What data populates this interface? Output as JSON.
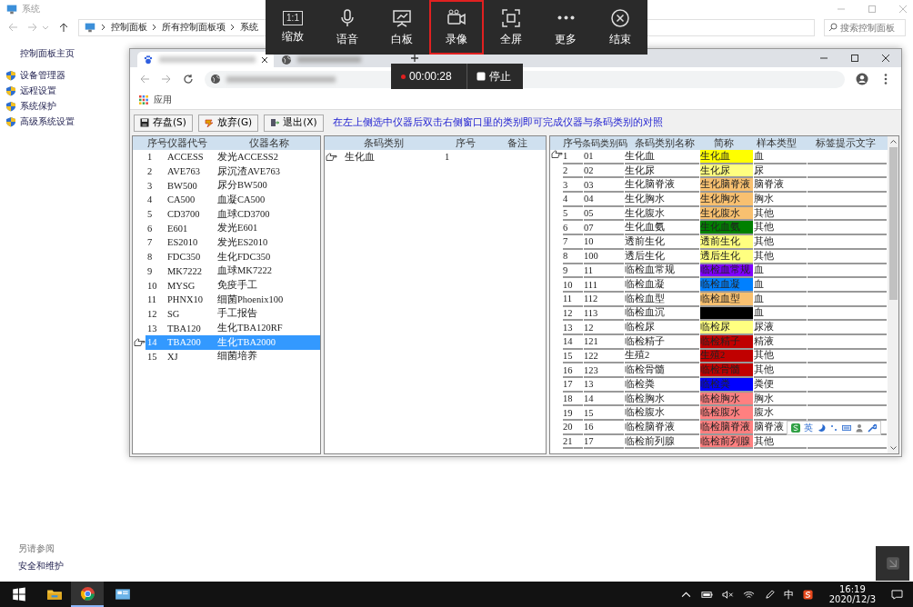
{
  "control_panel": {
    "title": "系统",
    "breadcrumb": [
      "控制面板",
      "所有控制面板项",
      "系统"
    ],
    "search": {
      "placeholder": "搜索控制面板"
    },
    "home_link": "控制面板主页",
    "links": [
      "设备管理器",
      "远程设置",
      "系统保护",
      "高级系统设置"
    ],
    "see_also": {
      "heading": "另请参阅",
      "links": [
        "安全和维护"
      ]
    }
  },
  "meeting_toolbar": {
    "items": [
      {
        "label": "缩放",
        "kind": "zoom",
        "glyph": "1:1",
        "selected": false
      },
      {
        "label": "语音",
        "kind": "mic",
        "selected": false
      },
      {
        "label": "白板",
        "kind": "whiteboard",
        "selected": false
      },
      {
        "label": "录像",
        "kind": "camera",
        "selected": true
      },
      {
        "label": "全屏",
        "kind": "fullscreen",
        "selected": false
      },
      {
        "label": "更多",
        "kind": "more",
        "selected": false
      },
      {
        "label": "结束",
        "kind": "end",
        "selected": false
      }
    ],
    "timer": {
      "time": "00:00:28",
      "stop": "停止"
    }
  },
  "browser": {
    "bookmarks": [
      "应用"
    ],
    "app": {
      "buttons": [
        {
          "label": "存盘(S)",
          "kind": "save"
        },
        {
          "label": "放弃(G)",
          "kind": "discard"
        },
        {
          "label": "退出(X)",
          "kind": "exit"
        }
      ],
      "hint": "在左上侧选中仪器后双击右侧窗口里的类别即可完成仪器与条码类别的对照",
      "instruments": {
        "columns": [
          "序号",
          "仪器代号",
          "仪器名称"
        ],
        "rows": [
          {
            "no": "1",
            "code": "ACCESS",
            "name": "发光ACCESS2",
            "selected": false
          },
          {
            "no": "2",
            "code": "AVE763",
            "name": "尿沉渣AVE763",
            "selected": false
          },
          {
            "no": "3",
            "code": "BW500",
            "name": "尿分BW500",
            "selected": false
          },
          {
            "no": "4",
            "code": "CA500",
            "name": "血凝CA500",
            "selected": false
          },
          {
            "no": "5",
            "code": "CD3700",
            "name": "血球CD3700",
            "selected": false
          },
          {
            "no": "6",
            "code": "E601",
            "name": "发光E601",
            "selected": false
          },
          {
            "no": "7",
            "code": "ES2010",
            "name": "发光ES2010",
            "selected": false
          },
          {
            "no": "8",
            "code": "FDC350",
            "name": "生化FDC350",
            "selected": false
          },
          {
            "no": "9",
            "code": "MK7222",
            "name": "血球MK7222",
            "selected": false
          },
          {
            "no": "10",
            "code": "MYSG",
            "name": "免疫手工",
            "selected": false
          },
          {
            "no": "11",
            "code": "PHNX10",
            "name": "细菌Phoenix100",
            "selected": false
          },
          {
            "no": "12",
            "code": "SG",
            "name": "手工报告",
            "selected": false
          },
          {
            "no": "13",
            "code": "TBA120",
            "name": "生化TBA120RF",
            "selected": false
          },
          {
            "no": "14",
            "code": "TBA200",
            "name": "生化TBA2000",
            "selected": true
          },
          {
            "no": "15",
            "code": "XJ",
            "name": "细菌培养",
            "selected": false
          }
        ]
      },
      "mapping": {
        "columns": [
          "条码类别",
          "序号",
          "备注"
        ],
        "rows": [
          {
            "category": "生化血",
            "no": "1",
            "current": true
          }
        ]
      },
      "categories": {
        "columns": [
          "序号",
          "条码类别码",
          "条码类别名称",
          "简称",
          "样本类型",
          "标签提示文字"
        ],
        "rows": [
          {
            "no": "1",
            "code": "01",
            "name": "生化血",
            "abbr": "生化血",
            "color": "#ffff00",
            "sample": "血",
            "current": true
          },
          {
            "no": "2",
            "code": "02",
            "name": "生化尿",
            "abbr": "生化尿",
            "color": "#ffff80",
            "sample": "尿",
            "current": false
          },
          {
            "no": "3",
            "code": "03",
            "name": "生化脑脊液",
            "abbr": "生化脑脊液",
            "color": "#f8c070",
            "sample": "脑脊液",
            "current": false
          },
          {
            "no": "4",
            "code": "04",
            "name": "生化胸水",
            "abbr": "生化胸水",
            "color": "#f8c070",
            "sample": "胸水",
            "current": false
          },
          {
            "no": "5",
            "code": "05",
            "name": "生化腹水",
            "abbr": "生化腹水",
            "color": "#f8c070",
            "sample": "其他",
            "current": false
          },
          {
            "no": "6",
            "code": "07",
            "name": "生化血氨",
            "abbr": "生化血氨",
            "color": "#008000",
            "sample": "其他",
            "current": false
          },
          {
            "no": "7",
            "code": "10",
            "name": "透前生化",
            "abbr": "透前生化",
            "color": "#ffff80",
            "sample": "其他",
            "current": false
          },
          {
            "no": "8",
            "code": "100",
            "name": "透后生化",
            "abbr": "透后生化",
            "color": "#ffff80",
            "sample": "其他",
            "current": false
          },
          {
            "no": "9",
            "code": "11",
            "name": "临检血常规",
            "abbr": "临检血常规",
            "color": "#8000ff",
            "sample": "血",
            "current": false
          },
          {
            "no": "10",
            "code": "111",
            "name": "临检血凝",
            "abbr": "临检血凝",
            "color": "#0080ff",
            "sample": "血",
            "current": false
          },
          {
            "no": "11",
            "code": "112",
            "name": "临检血型",
            "abbr": "临检血型",
            "color": "#f8c070",
            "sample": "血",
            "current": false
          },
          {
            "no": "12",
            "code": "113",
            "name": "临检血沉",
            "color": "#000000",
            "sample": "血",
            "current": false
          },
          {
            "no": "13",
            "code": "12",
            "name": "临检尿",
            "abbr": "临检尿",
            "color": "#ffff80",
            "sample": "尿液",
            "current": false
          },
          {
            "no": "14",
            "code": "121",
            "name": "临检精子",
            "abbr": "临检精子",
            "color": "#c00000",
            "sample": "精液",
            "current": false
          },
          {
            "no": "15",
            "code": "122",
            "name": "生殖2",
            "abbr": "生殖2",
            "color": "#c00000",
            "sample": "其他",
            "current": false
          },
          {
            "no": "16",
            "code": "123",
            "name": "临检骨髓",
            "abbr": "临检骨髓",
            "color": "#c00000",
            "sample": "其他",
            "current": false
          },
          {
            "no": "17",
            "code": "13",
            "name": "临检粪",
            "abbr": "临检粪",
            "color": "#0000ff",
            "sample": "粪便",
            "current": false
          },
          {
            "no": "18",
            "code": "14",
            "name": "临检胸水",
            "abbr": "临检胸水",
            "color": "#ff8080",
            "sample": "胸水",
            "current": false
          },
          {
            "no": "19",
            "code": "15",
            "name": "临检腹水",
            "abbr": "临检腹水",
            "color": "#ff8080",
            "sample": "腹水",
            "current": false
          },
          {
            "no": "20",
            "code": "16",
            "name": "临检脑脊液",
            "abbr": "临检脑脊液",
            "color": "#ff8080",
            "sample": "脑脊液",
            "current": false
          },
          {
            "no": "21",
            "code": "17",
            "name": "临检前列腺",
            "abbr": "临检前列腺",
            "color": "#ff8080",
            "sample": "其他",
            "current": false
          }
        ]
      },
      "ime_bar": {
        "mode": "英"
      }
    }
  },
  "taskbar": {
    "ime": "中",
    "time": "16:19",
    "date": "2020/12/3"
  }
}
